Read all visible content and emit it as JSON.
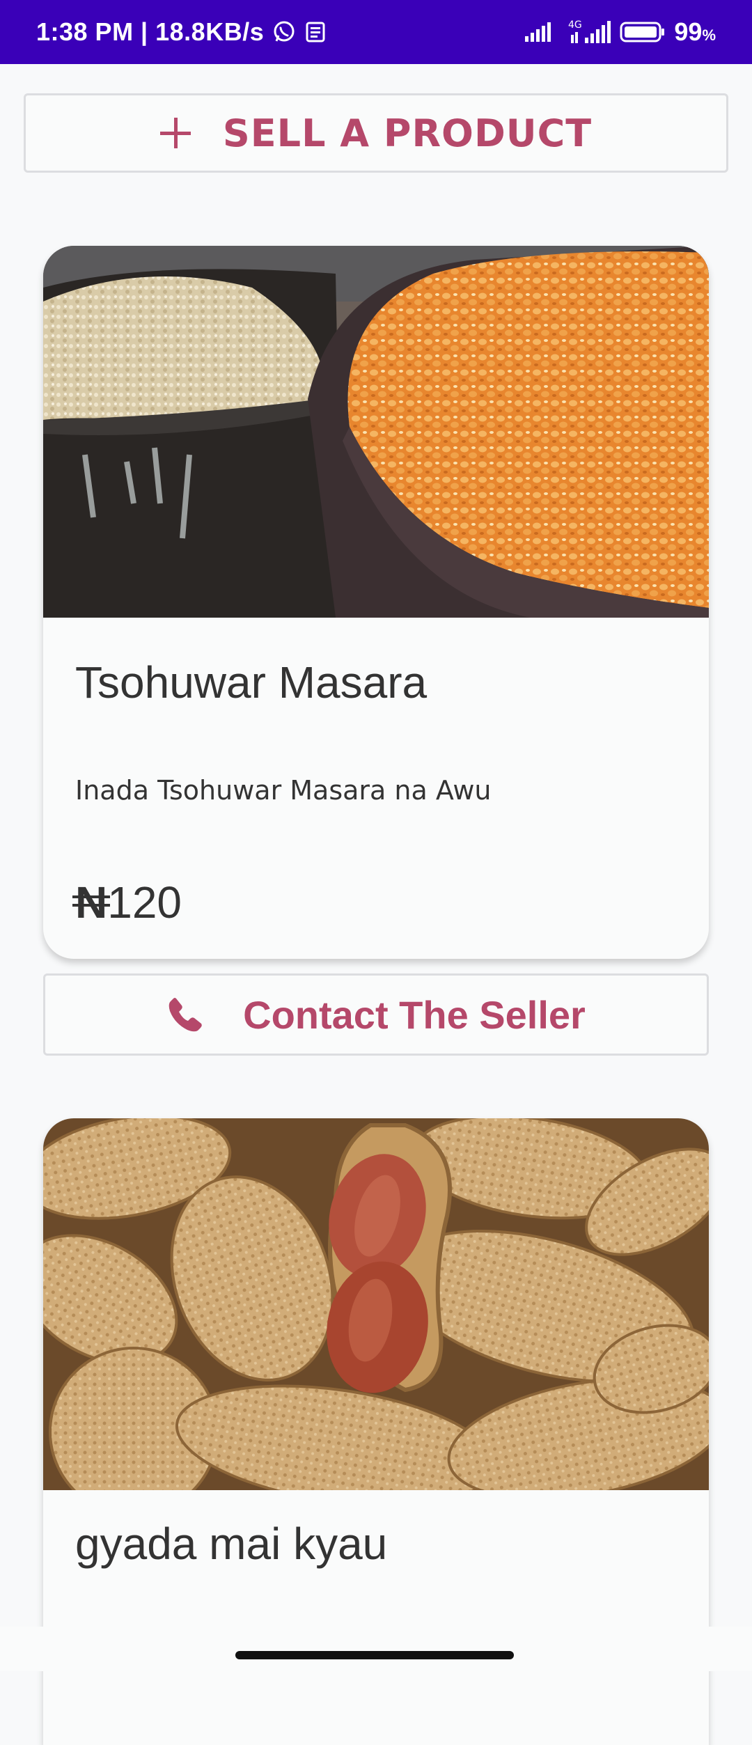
{
  "status_bar": {
    "time_speed": "1:38 PM | 18.8KB/s",
    "battery_percent": "99",
    "battery_unit": "%",
    "network_label": "4G",
    "background_color": "#3a00b8",
    "icons": [
      "whatsapp-icon",
      "news-icon",
      "signal-icon",
      "4g-signal-icon",
      "battery-icon"
    ]
  },
  "sell_button": {
    "label": "SELL A PRODUCT",
    "icon": "plus-icon",
    "accent_color": "#b5486a"
  },
  "products": [
    {
      "title": "Tsohuwar Masara",
      "description": "Inada Tsohuwar Masara na Awu",
      "currency_symbol": "N",
      "price": "120",
      "image": "maize-grain-basins-photo"
    },
    {
      "title": "gyada mai kyau",
      "image": "groundnuts-photo"
    }
  ],
  "contact_button": {
    "label": "Contact The Seller",
    "icon": "phone-icon"
  }
}
